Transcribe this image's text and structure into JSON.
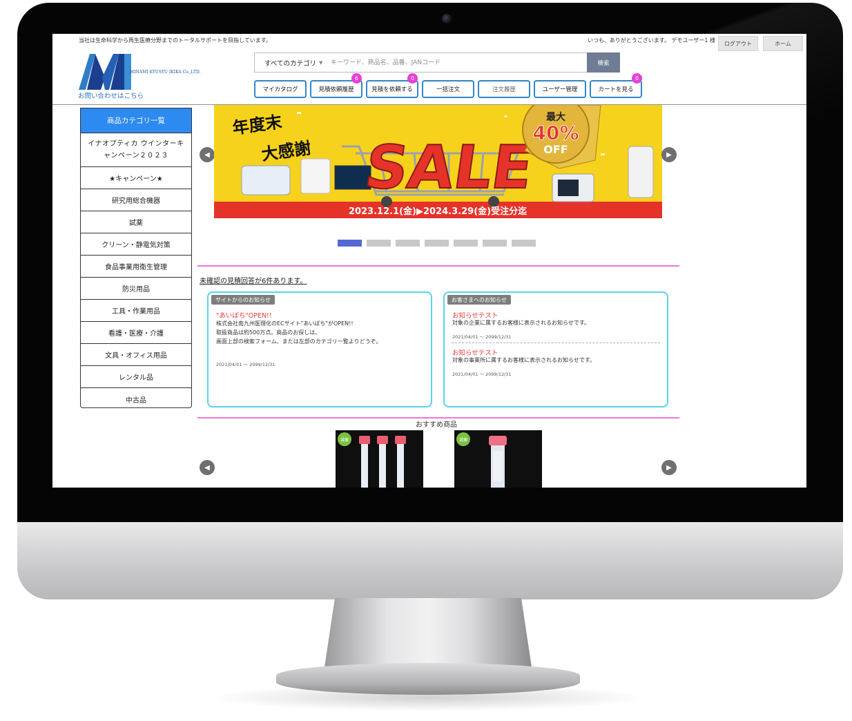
{
  "site": {
    "tagline": "当社は生命科学から再生医療分野までのトータルサポートを目指しています。",
    "greeting": "いつも、ありがとうございます。 デモユーザー1 様",
    "logout_label": "ログアウト",
    "home_label": "ホーム",
    "logo_text": "MINAMI KYUSYU IKIKA Co.,LTD.",
    "contact_label": "お問い合わせはこちら"
  },
  "search": {
    "category_label": "すべてのカテゴリ",
    "placeholder": "キーワード、商品名、品番、JANコード",
    "button_label": "検索"
  },
  "nav": {
    "buttons": [
      {
        "label": "マイカタログ"
      },
      {
        "label": "見積依頼履歴",
        "badge": "6"
      },
      {
        "label": "見積を依頼する",
        "badge": "0"
      },
      {
        "label": "一括注文"
      },
      {
        "label": "注文履歴"
      },
      {
        "label": "ユーザー管理"
      },
      {
        "label": "カートを見る",
        "badge": "0"
      }
    ]
  },
  "sidebar": {
    "heading": "商品カテゴリ一覧",
    "items": [
      {
        "label": "イナオプティカ ウインターキャンペーン２０２３"
      },
      {
        "label": "★キャンペーン★"
      },
      {
        "label": "研究用総合機器"
      },
      {
        "label": "試薬"
      },
      {
        "label": "クリーン・静電気対策"
      },
      {
        "label": "食品事業用衛生管理"
      },
      {
        "label": "防災用品"
      },
      {
        "label": "工具・作業用品"
      },
      {
        "label": "看護・医療・介護"
      },
      {
        "label": "文具・オフィス用品"
      },
      {
        "label": "レンタル品"
      },
      {
        "label": "中古品"
      }
    ]
  },
  "banner": {
    "headline_1": "年度末",
    "headline_2": "大感謝",
    "sale_text": "SALE",
    "discount_top": "最大",
    "discount_value": "40%",
    "discount_bottom": "OFF",
    "period_text": "2023.12.1(金)▶2024.3.29(金)受注分迄"
  },
  "notice_link": "未確認の見積回答が6件あります。",
  "site_news": {
    "tag": "サイトからのお知らせ",
    "title": "\"あいぽち\"OPEN!!",
    "lines": [
      "株式会社南九州医理化のECサイト\"あいぽち\"がOPEN!!",
      "取扱商品は約500万点。商品のお探しは、",
      "画面上部の検索フォーム、または左部のカテゴリ一覧よりどうぞ。"
    ],
    "date": "2021/04/01 ～ 2099/12/31"
  },
  "customer_news": {
    "tag": "お客さまへのお知らせ",
    "items": [
      {
        "title": "お知らせテスト",
        "text": "対象の企業に属するお客様に表示されるお知らせです。",
        "date": "2021/04/01 ～ 2099/12/31"
      },
      {
        "title": "お知らせテスト",
        "text": "対象の事業所に属するお客様に表示されるお知らせです。",
        "date": "2021/04/01 ～ 2099/12/31"
      }
    ]
  },
  "recommended": {
    "title": "おすすめ商品",
    "badge": "減薬"
  },
  "colors": {
    "accent_blue": "#2d8af0",
    "nav_border": "#2f86c9",
    "badge_pink": "#e740d8",
    "news_border": "#58d3ef",
    "divider_pink": "#e977e0",
    "news_title_red": "#e63b3b"
  }
}
